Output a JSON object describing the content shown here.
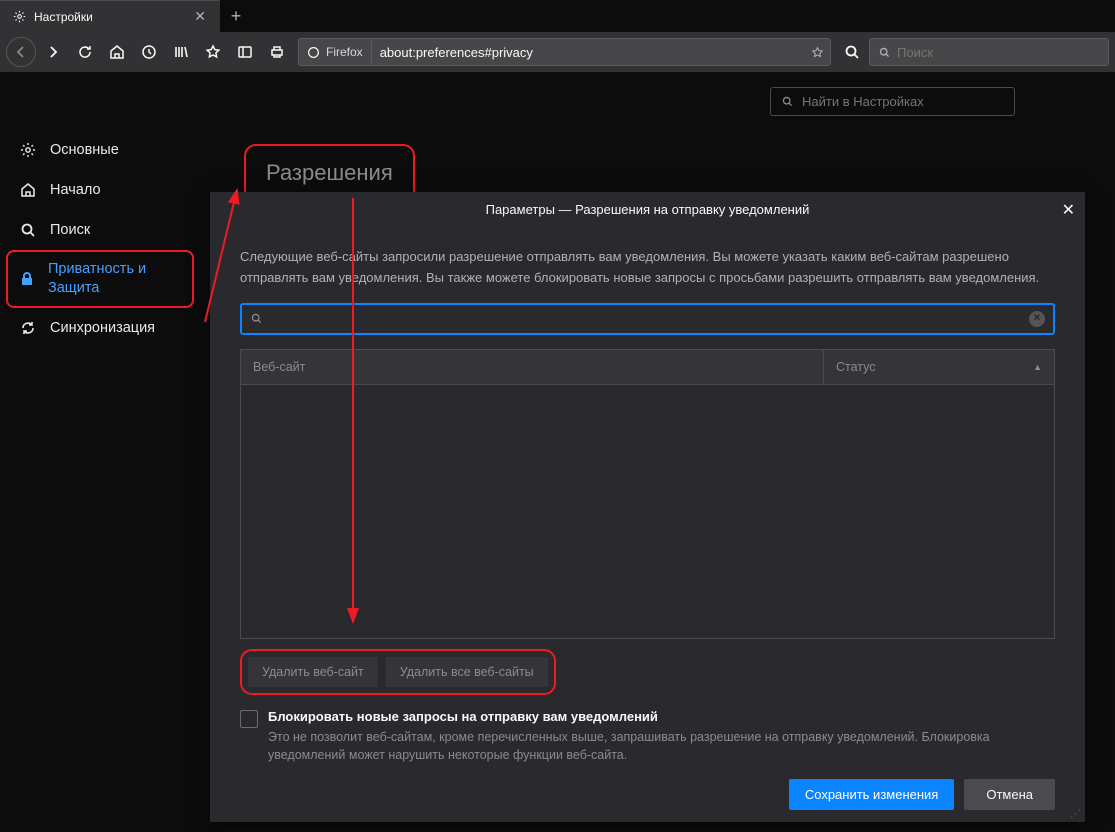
{
  "tab": {
    "title": "Настройки"
  },
  "urlbar": {
    "identity": "Firefox",
    "url": "about:preferences#privacy"
  },
  "searchbar": {
    "placeholder": "Поиск"
  },
  "findbox": {
    "placeholder": "Найти в Настройках"
  },
  "sidebar": {
    "items": [
      {
        "label": "Основные"
      },
      {
        "label": "Начало"
      },
      {
        "label": "Поиск"
      },
      {
        "label": "Приватность и Защита"
      },
      {
        "label": "Синхронизация"
      }
    ]
  },
  "section": {
    "title": "Разрешения"
  },
  "dialog": {
    "title": "Параметры — Разрешения на отправку уведомлений",
    "desc": "Следующие веб-сайты запросили разрешение отправлять вам уведомления. Вы можете указать каким веб-сайтам разрешено отправлять вам уведомления. Вы также можете блокировать новые запросы с просьбами разрешить отправлять вам уведомления.",
    "table": {
      "c1": "Веб-сайт",
      "c2": "Статус"
    },
    "btn_remove": "Удалить веб-сайт",
    "btn_remove_all": "Удалить все веб-сайты",
    "chk_label": "Блокировать новые запросы на отправку вам уведомлений",
    "chk_desc": "Это не позволит веб-сайтам, кроме перечисленных выше, запрашивать разрешение на отправку уведомлений. Блокировка уведомлений может нарушить некоторые функции веб-сайта.",
    "btn_save": "Сохранить изменения",
    "btn_cancel": "Отмена"
  }
}
